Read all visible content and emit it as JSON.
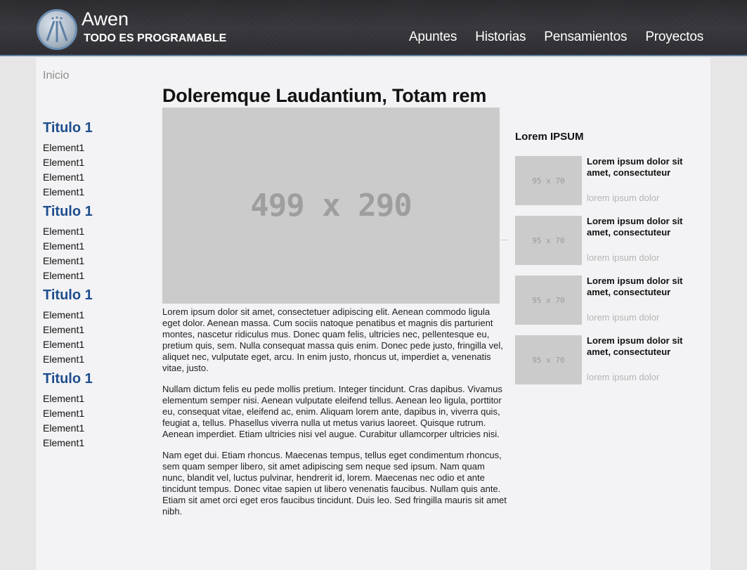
{
  "header": {
    "title": "Awen",
    "tagline": "TODO ES PROGRAMABLE",
    "logo_icon": "awen-logo-icon",
    "nav": [
      "Apuntes",
      "Historias",
      "Pensamientos",
      "Proyectos"
    ]
  },
  "breadcrumb": "Inicio",
  "leftnav": [
    {
      "title": "Titulo 1",
      "items": [
        "Element1",
        "Element1",
        "Element1",
        "Element1"
      ]
    },
    {
      "title": "Titulo 1",
      "items": [
        "Element1",
        "Element1",
        "Element1",
        "Element1"
      ]
    },
    {
      "title": "Titulo 1",
      "items": [
        "Element1",
        "Element1",
        "Element1",
        "Element1"
      ]
    },
    {
      "title": "Titulo 1",
      "items": [
        "Element1",
        "Element1",
        "Element1",
        "Element1"
      ]
    }
  ],
  "main": {
    "title": "Doleremque Laudantium, Totam rem",
    "hero_placeholder": "499 x 290",
    "paragraphs": [
      "Lorem ipsum dolor sit amet, consectetuer adipiscing elit. Aenean commodo ligula eget dolor. Aenean massa. Cum sociis natoque penatibus et magnis dis parturient montes, nascetur ridiculus mus. Donec quam felis, ultricies nec, pellentesque eu, pretium quis, sem. Nulla consequat massa quis enim. Donec pede justo, fringilla vel, aliquet nec, vulputate eget, arcu. In enim justo, rhoncus ut, imperdiet a, venenatis vitae, justo.",
      "Nullam dictum felis eu pede mollis pretium. Integer tincidunt. Cras dapibus. Vivamus elementum semper nisi. Aenean vulputate eleifend tellus. Aenean leo ligula, porttitor eu, consequat vitae, eleifend ac, enim. Aliquam lorem ante, dapibus in, viverra quis, feugiat a, tellus. Phasellus viverra nulla ut metus varius laoreet. Quisque rutrum. Aenean imperdiet. Etiam ultricies nisi vel augue. Curabitur ullamcorper ultricies nisi.",
      "Nam eget dui. Etiam rhoncus. Maecenas tempus, tellus eget condimentum rhoncus, sem quam semper libero, sit amet adipiscing sem neque sed ipsum. Nam quam nunc, blandit vel, luctus pulvinar, hendrerit id, lorem. Maecenas nec odio et ante tincidunt tempus. Donec vitae sapien ut libero venenatis faucibus. Nullam quis ante. Etiam sit amet orci eget eros faucibus tincidunt. Duis leo. Sed fringilla mauris sit amet nibh."
    ]
  },
  "sidebar": {
    "title": "Lorem IPSUM",
    "cards": [
      {
        "thumb": "95 x 70",
        "title": "Lorem ipsum dolor sit amet, consectuteur",
        "subtitle": "lorem ipsum dolor"
      },
      {
        "thumb": "95 x 70",
        "title": "Lorem ipsum dolor sit amet, consectuteur",
        "subtitle": "lorem ipsum dolor"
      },
      {
        "thumb": "95 x 70",
        "title": "Lorem ipsum dolor sit amet, consectuteur",
        "subtitle": "lorem ipsum dolor"
      },
      {
        "thumb": "95 x 70",
        "title": "Lorem ipsum dolor sit amet, consectuteur",
        "subtitle": "lorem ipsum dolor"
      }
    ]
  },
  "colors": {
    "accent": "#1f4e8d",
    "header_border": "#5e7fa3",
    "placeholder": "#cbcbcb"
  }
}
